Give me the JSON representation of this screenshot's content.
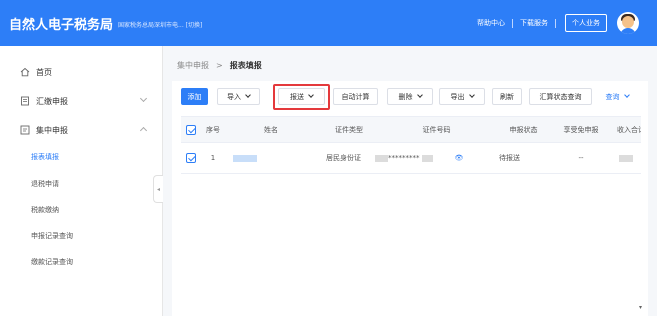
{
  "header": {
    "title": "自然人电子税务局",
    "subtitle": "国家税务总局深圳市电... [切换]",
    "help_label": "帮助中心",
    "download_label": "下载服务",
    "business_label": "个人业务"
  },
  "sidebar": {
    "items": [
      {
        "label": "首页",
        "icon": "home-icon"
      },
      {
        "label": "汇缴申报",
        "icon": "document-icon"
      },
      {
        "label": "集中申报",
        "icon": "form-icon"
      }
    ],
    "sub_items": [
      {
        "label": "报表填报",
        "active": true
      },
      {
        "label": "退税申请",
        "active": false
      },
      {
        "label": "税款缴纳",
        "active": false
      },
      {
        "label": "申报记录查询",
        "active": false
      },
      {
        "label": "缴款记录查询",
        "active": false
      }
    ],
    "collapse_glyph": "◂"
  },
  "breadcrumb": {
    "parent": "集中申报",
    "separator": ">",
    "current": "报表填报"
  },
  "toolbar": {
    "add": "添加",
    "import": "导入",
    "submit": "报送",
    "auto_calc": "自动计算",
    "delete": "删除",
    "export": "导出",
    "refresh": "刷新",
    "summary_query": "汇算状态查询",
    "query": "查询"
  },
  "table": {
    "columns": [
      "序号",
      "姓名",
      "证件类型",
      "证件号码",
      "申报状态",
      "享受免申报",
      "收入合计"
    ],
    "rows": [
      {
        "index": "1",
        "id_type": "居民身份证",
        "id_number_masked": "*********",
        "status": "待报送",
        "exempt": "--"
      }
    ],
    "eye_glyph": "👁"
  },
  "colors": {
    "primary": "#2d7ef7",
    "highlight": "#e4393c"
  }
}
